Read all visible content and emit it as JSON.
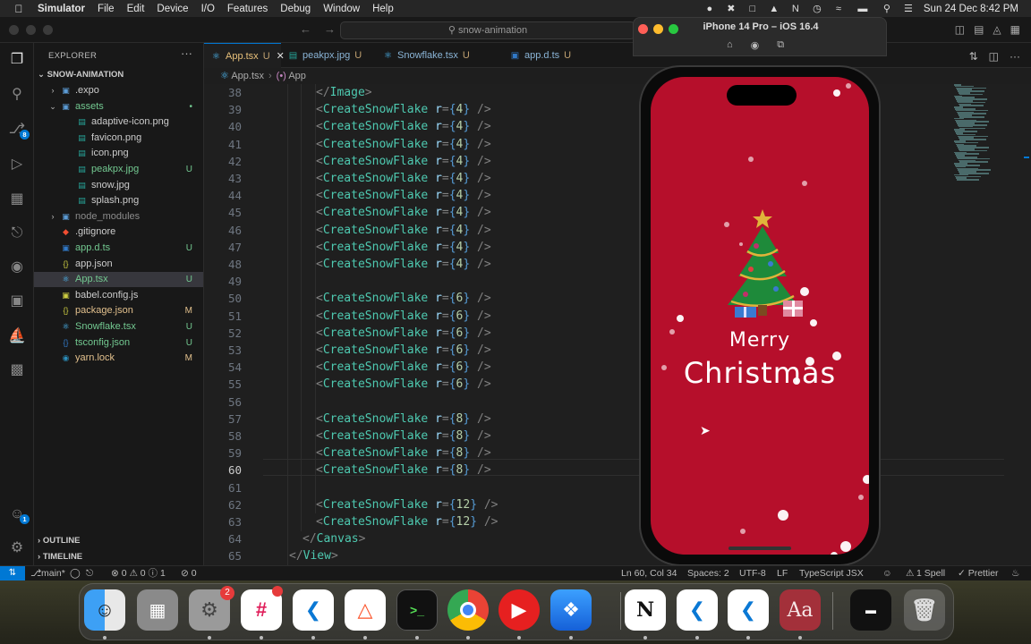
{
  "menubar": {
    "app": "Simulator",
    "items": [
      "File",
      "Edit",
      "Device",
      "I/O",
      "Features",
      "Debug",
      "Window",
      "Help"
    ],
    "clock": "Sun 24 Dec  8:42 PM"
  },
  "titlebar": {
    "search": "snow-animation"
  },
  "activity": {
    "scm_badge": "8",
    "account_badge": "1"
  },
  "explorer": {
    "title": "EXPLORER",
    "project": "SNOW-ANIMATION",
    "items": [
      {
        "name": ".expo",
        "indent": 1,
        "kind": "folder",
        "open": false,
        "flag": ""
      },
      {
        "name": "assets",
        "indent": 1,
        "kind": "folder",
        "open": true,
        "flag": "•"
      },
      {
        "name": "adaptive-icon.png",
        "indent": 2,
        "kind": "image",
        "flag": ""
      },
      {
        "name": "favicon.png",
        "indent": 2,
        "kind": "image",
        "flag": ""
      },
      {
        "name": "icon.png",
        "indent": 2,
        "kind": "image",
        "flag": ""
      },
      {
        "name": "peakpx.jpg",
        "indent": 2,
        "kind": "image",
        "flag": "U"
      },
      {
        "name": "snow.jpg",
        "indent": 2,
        "kind": "image",
        "flag": ""
      },
      {
        "name": "splash.png",
        "indent": 2,
        "kind": "image",
        "flag": ""
      },
      {
        "name": "node_modules",
        "indent": 1,
        "kind": "folder",
        "open": false,
        "flag": ""
      },
      {
        "name": ".gitignore",
        "indent": 1,
        "kind": "git",
        "flag": ""
      },
      {
        "name": "app.d.ts",
        "indent": 1,
        "kind": "ts",
        "flag": "U"
      },
      {
        "name": "app.json",
        "indent": 1,
        "kind": "json",
        "flag": ""
      },
      {
        "name": "App.tsx",
        "indent": 1,
        "kind": "react",
        "flag": "U",
        "selected": true
      },
      {
        "name": "babel.config.js",
        "indent": 1,
        "kind": "js",
        "flag": ""
      },
      {
        "name": "package.json",
        "indent": 1,
        "kind": "json",
        "flag": "M"
      },
      {
        "name": "Snowflake.tsx",
        "indent": 1,
        "kind": "react",
        "flag": "U"
      },
      {
        "name": "tsconfig.json",
        "indent": 1,
        "kind": "tsjson",
        "flag": "U"
      },
      {
        "name": "yarn.lock",
        "indent": 1,
        "kind": "yarn",
        "flag": "M"
      }
    ],
    "outline": "OUTLINE",
    "timeline": "TIMELINE"
  },
  "tabs": [
    {
      "label": "App.tsx",
      "flag": "U",
      "active": true
    },
    {
      "label": "peakpx.jpg",
      "flag": "U",
      "active": false
    },
    {
      "label": "Snowflake.tsx",
      "flag": "U",
      "active": false
    },
    {
      "label": "app.d.ts",
      "flag": "U",
      "active": false
    }
  ],
  "breadcrumb": {
    "file": "App.tsx",
    "symbol": "App"
  },
  "code": [
    {
      "n": "38",
      "indent": 3,
      "kind": "close",
      "tag": "Image"
    },
    {
      "n": "39",
      "indent": 3,
      "kind": "flake",
      "r": "4"
    },
    {
      "n": "40",
      "indent": 3,
      "kind": "flake",
      "r": "4"
    },
    {
      "n": "41",
      "indent": 3,
      "kind": "flake",
      "r": "4"
    },
    {
      "n": "42",
      "indent": 3,
      "kind": "flake",
      "r": "4"
    },
    {
      "n": "43",
      "indent": 3,
      "kind": "flake",
      "r": "4"
    },
    {
      "n": "44",
      "indent": 3,
      "kind": "flake",
      "r": "4"
    },
    {
      "n": "45",
      "indent": 3,
      "kind": "flake",
      "r": "4"
    },
    {
      "n": "46",
      "indent": 3,
      "kind": "flake",
      "r": "4"
    },
    {
      "n": "47",
      "indent": 3,
      "kind": "flake",
      "r": "4"
    },
    {
      "n": "48",
      "indent": 3,
      "kind": "flake",
      "r": "4"
    },
    {
      "n": "49",
      "indent": 0,
      "kind": "blank"
    },
    {
      "n": "50",
      "indent": 3,
      "kind": "flake",
      "r": "6"
    },
    {
      "n": "51",
      "indent": 3,
      "kind": "flake",
      "r": "6"
    },
    {
      "n": "52",
      "indent": 3,
      "kind": "flake",
      "r": "6"
    },
    {
      "n": "53",
      "indent": 3,
      "kind": "flake",
      "r": "6"
    },
    {
      "n": "54",
      "indent": 3,
      "kind": "flake",
      "r": "6"
    },
    {
      "n": "55",
      "indent": 3,
      "kind": "flake",
      "r": "6"
    },
    {
      "n": "56",
      "indent": 0,
      "kind": "blank"
    },
    {
      "n": "57",
      "indent": 3,
      "kind": "flake",
      "r": "8"
    },
    {
      "n": "58",
      "indent": 3,
      "kind": "flake",
      "r": "8"
    },
    {
      "n": "59",
      "indent": 3,
      "kind": "flake",
      "r": "8"
    },
    {
      "n": "60",
      "indent": 3,
      "kind": "flake",
      "r": "8",
      "current": true
    },
    {
      "n": "61",
      "indent": 0,
      "kind": "blank"
    },
    {
      "n": "62",
      "indent": 3,
      "kind": "flake",
      "r": "12"
    },
    {
      "n": "63",
      "indent": 3,
      "kind": "flake",
      "r": "12"
    },
    {
      "n": "64",
      "indent": 2,
      "kind": "close",
      "tag": "Canvas"
    },
    {
      "n": "65",
      "indent": 1,
      "kind": "close",
      "tag": "View"
    }
  ],
  "simulator": {
    "title": "iPhone 14 Pro – iOS 16.4",
    "greeting_line1": "Merry",
    "greeting_line2": "Christmas",
    "background": "#b60f2b"
  },
  "statusbar": {
    "branch": "main*",
    "problems": "⊗ 0 ⚠ 0 ⓘ 1",
    "ports": "⊘ 0",
    "position": "Ln 60, Col 34",
    "spaces": "Spaces: 2",
    "encoding": "UTF-8",
    "eol": "LF",
    "language": "TypeScript JSX",
    "spell": "1 Spell",
    "formatter": "✓ Prettier"
  },
  "dock": {
    "settings_badge": "2",
    "notion_label": "N",
    "dictionary_label": "Aa"
  }
}
